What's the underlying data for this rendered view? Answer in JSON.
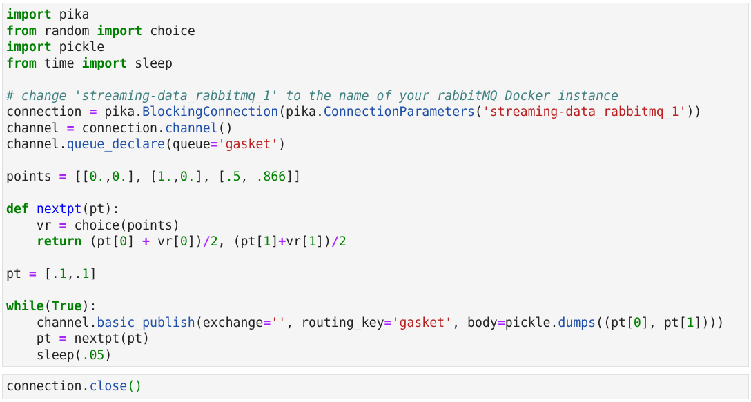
{
  "cells": [
    {
      "id": "cell-1",
      "lines": [
        [
          [
            "kw",
            "import"
          ],
          [
            "plain",
            " pika"
          ]
        ],
        [
          [
            "kw",
            "from"
          ],
          [
            "plain",
            " random "
          ],
          [
            "kw",
            "import"
          ],
          [
            "plain",
            " choice"
          ]
        ],
        [
          [
            "kw",
            "import"
          ],
          [
            "plain",
            " pickle"
          ]
        ],
        [
          [
            "kw",
            "from"
          ],
          [
            "plain",
            " time "
          ],
          [
            "kw",
            "import"
          ],
          [
            "plain",
            " sleep"
          ]
        ],
        [],
        [
          [
            "cm",
            "# change 'streaming-data_rabbitmq_1' to the name of your rabbitMQ Docker instance"
          ]
        ],
        [
          [
            "plain",
            "connection "
          ],
          [
            "op",
            "="
          ],
          [
            "plain",
            " pika."
          ],
          [
            "attr",
            "BlockingConnection"
          ],
          [
            "plain",
            "(pika."
          ],
          [
            "attr",
            "ConnectionParameters"
          ],
          [
            "plain",
            "("
          ],
          [
            "str",
            "'streaming-data_rabbitmq_1'"
          ],
          [
            "plain",
            "))"
          ]
        ],
        [
          [
            "plain",
            "channel "
          ],
          [
            "op",
            "="
          ],
          [
            "plain",
            " connection."
          ],
          [
            "attr",
            "channel"
          ],
          [
            "plain",
            "()"
          ]
        ],
        [
          [
            "plain",
            "channel."
          ],
          [
            "attr",
            "queue_declare"
          ],
          [
            "plain",
            "(queue"
          ],
          [
            "op",
            "="
          ],
          [
            "str",
            "'gasket'"
          ],
          [
            "plain",
            ")"
          ]
        ],
        [],
        [
          [
            "plain",
            "points "
          ],
          [
            "op",
            "="
          ],
          [
            "plain",
            " [["
          ],
          [
            "num",
            "0."
          ],
          [
            "plain",
            ","
          ],
          [
            "num",
            "0."
          ],
          [
            "plain",
            "], ["
          ],
          [
            "num",
            "1."
          ],
          [
            "plain",
            ","
          ],
          [
            "num",
            "0."
          ],
          [
            "plain",
            "], ["
          ],
          [
            "num",
            ".5"
          ],
          [
            "plain",
            ", "
          ],
          [
            "num",
            ".866"
          ],
          [
            "plain",
            "]]"
          ]
        ],
        [],
        [
          [
            "kw",
            "def"
          ],
          [
            "plain",
            " "
          ],
          [
            "fn",
            "nextpt"
          ],
          [
            "plain",
            "(pt):"
          ]
        ],
        [
          [
            "plain",
            "    vr "
          ],
          [
            "op",
            "="
          ],
          [
            "plain",
            " choice(points)"
          ]
        ],
        [
          [
            "plain",
            "    "
          ],
          [
            "kw",
            "return"
          ],
          [
            "plain",
            " (pt["
          ],
          [
            "num",
            "0"
          ],
          [
            "plain",
            "] "
          ],
          [
            "op",
            "+"
          ],
          [
            "plain",
            " vr["
          ],
          [
            "num",
            "0"
          ],
          [
            "plain",
            "])"
          ],
          [
            "op",
            "/"
          ],
          [
            "num",
            "2"
          ],
          [
            "plain",
            ", (pt["
          ],
          [
            "num",
            "1"
          ],
          [
            "plain",
            "]"
          ],
          [
            "op",
            "+"
          ],
          [
            "plain",
            "vr["
          ],
          [
            "num",
            "1"
          ],
          [
            "plain",
            "])"
          ],
          [
            "op",
            "/"
          ],
          [
            "num",
            "2"
          ]
        ],
        [],
        [
          [
            "plain",
            "pt "
          ],
          [
            "op",
            "="
          ],
          [
            "plain",
            " [."
          ],
          [
            "num",
            "1"
          ],
          [
            "plain",
            ",."
          ],
          [
            "num",
            "1"
          ],
          [
            "plain",
            "]"
          ]
        ],
        [],
        [
          [
            "kw",
            "while"
          ],
          [
            "plain",
            "("
          ],
          [
            "kw",
            "True"
          ],
          [
            "plain",
            "):"
          ]
        ],
        [
          [
            "plain",
            "    channel."
          ],
          [
            "attr",
            "basic_publish"
          ],
          [
            "plain",
            "(exchange"
          ],
          [
            "op",
            "="
          ],
          [
            "str",
            "''"
          ],
          [
            "plain",
            ", routing_key"
          ],
          [
            "op",
            "="
          ],
          [
            "str",
            "'gasket'"
          ],
          [
            "plain",
            ", body"
          ],
          [
            "op",
            "="
          ],
          [
            "plain",
            "pickle."
          ],
          [
            "attr",
            "dumps"
          ],
          [
            "plain",
            "((pt["
          ],
          [
            "num",
            "0"
          ],
          [
            "plain",
            "], pt["
          ],
          [
            "num",
            "1"
          ],
          [
            "plain",
            "]))"
          ],
          [
            "plain",
            ")"
          ]
        ],
        [
          [
            "plain",
            "    pt "
          ],
          [
            "op",
            "="
          ],
          [
            "plain",
            " nextpt(pt)"
          ]
        ],
        [
          [
            "plain",
            "    sleep("
          ],
          [
            "num",
            ".05"
          ],
          [
            "plain",
            ")"
          ]
        ]
      ]
    },
    {
      "id": "cell-2",
      "lines": [
        [
          [
            "plain",
            "connection."
          ],
          [
            "attr",
            "close"
          ],
          [
            "paren-g",
            "()"
          ]
        ]
      ]
    }
  ]
}
